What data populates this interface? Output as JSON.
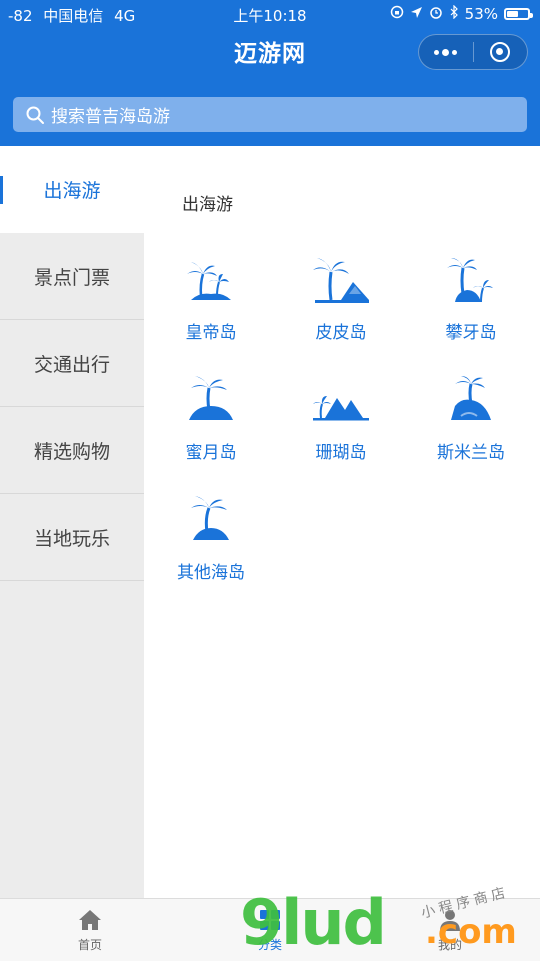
{
  "status_bar": {
    "signal": "-82",
    "carrier": "中国电信",
    "network": "4G",
    "time": "上午10:18",
    "battery": "53%"
  },
  "nav": {
    "title": "迈游网"
  },
  "search": {
    "placeholder": "搜索普吉海岛游"
  },
  "sidebar": {
    "items": [
      {
        "label": "出海游",
        "active": true
      },
      {
        "label": "景点门票",
        "active": false
      },
      {
        "label": "交通出行",
        "active": false
      },
      {
        "label": "精选购物",
        "active": false
      },
      {
        "label": "当地玩乐",
        "active": false
      }
    ]
  },
  "content": {
    "section_title": "出海游",
    "islands": [
      {
        "label": "皇帝岛",
        "icon": "palm-trees-icon"
      },
      {
        "label": "皮皮岛",
        "icon": "palm-mountain-icon"
      },
      {
        "label": "攀牙岛",
        "icon": "palm-rock-icon"
      },
      {
        "label": "蜜月岛",
        "icon": "palm-island-icon"
      },
      {
        "label": "珊瑚岛",
        "icon": "mountain-palm-icon"
      },
      {
        "label": "斯米兰岛",
        "icon": "island-cliff-icon"
      },
      {
        "label": "其他海岛",
        "icon": "palm-island-icon"
      }
    ]
  },
  "tabbar": {
    "items": [
      {
        "label": "首页",
        "icon": "home-icon",
        "active": false
      },
      {
        "label": "分类",
        "icon": "category-icon",
        "active": true
      },
      {
        "label": "我的",
        "icon": "user-icon",
        "active": false
      }
    ]
  },
  "watermark": {
    "brand": "9lud",
    "tld": ".com",
    "tagline": "小程序商店"
  },
  "colors": {
    "primary": "#1a73d9",
    "sidebar_bg": "#ececec"
  }
}
